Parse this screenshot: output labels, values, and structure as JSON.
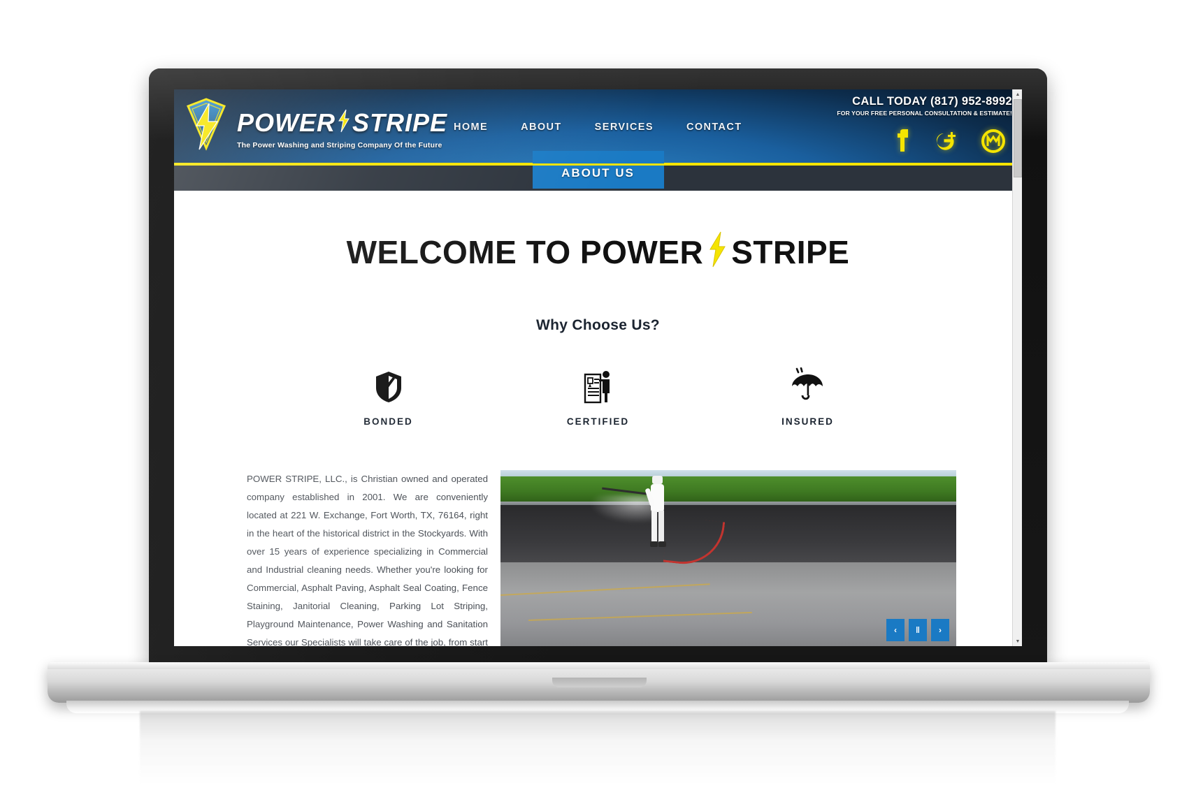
{
  "site": {
    "header": {
      "brand_first": "POWER",
      "brand_second": "STRIPE",
      "tagline": "The Power Washing and Striping Company Of the Future",
      "logo_icon": "lightning-bolt-shield-logo",
      "nav": [
        {
          "label": "HOME"
        },
        {
          "label": "ABOUT"
        },
        {
          "label": "SERVICES"
        },
        {
          "label": "CONTACT"
        }
      ],
      "call_today": "CALL TODAY (817) 952-8992",
      "call_sub": "FOR YOUR FREE PERSONAL CONSULTATION & ESTIMATE!",
      "social": [
        {
          "name": "facebook-icon",
          "glyph": "f"
        },
        {
          "name": "google-plus-icon",
          "glyph": "g+"
        },
        {
          "name": "merchant-circle-icon",
          "glyph": "m"
        }
      ],
      "accent_yellow": "#f5e400",
      "brand_blue": "#1a7ac4"
    },
    "sub_banner": {
      "page_tab_label": "ABOUT US"
    },
    "main": {
      "welcome_prefix": "WELCOME TO POWER",
      "welcome_suffix": "STRIPE",
      "welcome_bolt_icon": "lightning-bolt-icon",
      "why_choose_heading": "Why Choose Us?",
      "badges": [
        {
          "label": "BONDED",
          "icon": "shield-check-icon"
        },
        {
          "label": "CERTIFIED",
          "icon": "certificate-person-icon"
        },
        {
          "label": "INSURED",
          "icon": "umbrella-icon"
        }
      ],
      "about_paragraph": "POWER STRIPE, LLC., is Christian owned and operated company established in 2001. We are conveniently located at 221 W. Exchange, Fort Worth, TX, 76164, right in the heart of the historical district in the Stockyards. With over 15 years of experience specializing in Commercial and Industrial cleaning needs. Whether you're looking for Commercial, Asphalt Paving, Asphalt Seal Coating, Fence Staining, Janitorial Cleaning, Parking Lot Striping, Playground Maintenance, Power Washing and Sanitation Services our Specialists will take care of the job, from start to finish. We take pride",
      "slider": {
        "image_alt": "worker-spraying-asphalt-parking-lot",
        "prev_label": "‹",
        "pause_label": "‖",
        "next_label": "›"
      }
    },
    "scrollbar": {
      "up_label": "▲",
      "down_label": "▼"
    }
  }
}
